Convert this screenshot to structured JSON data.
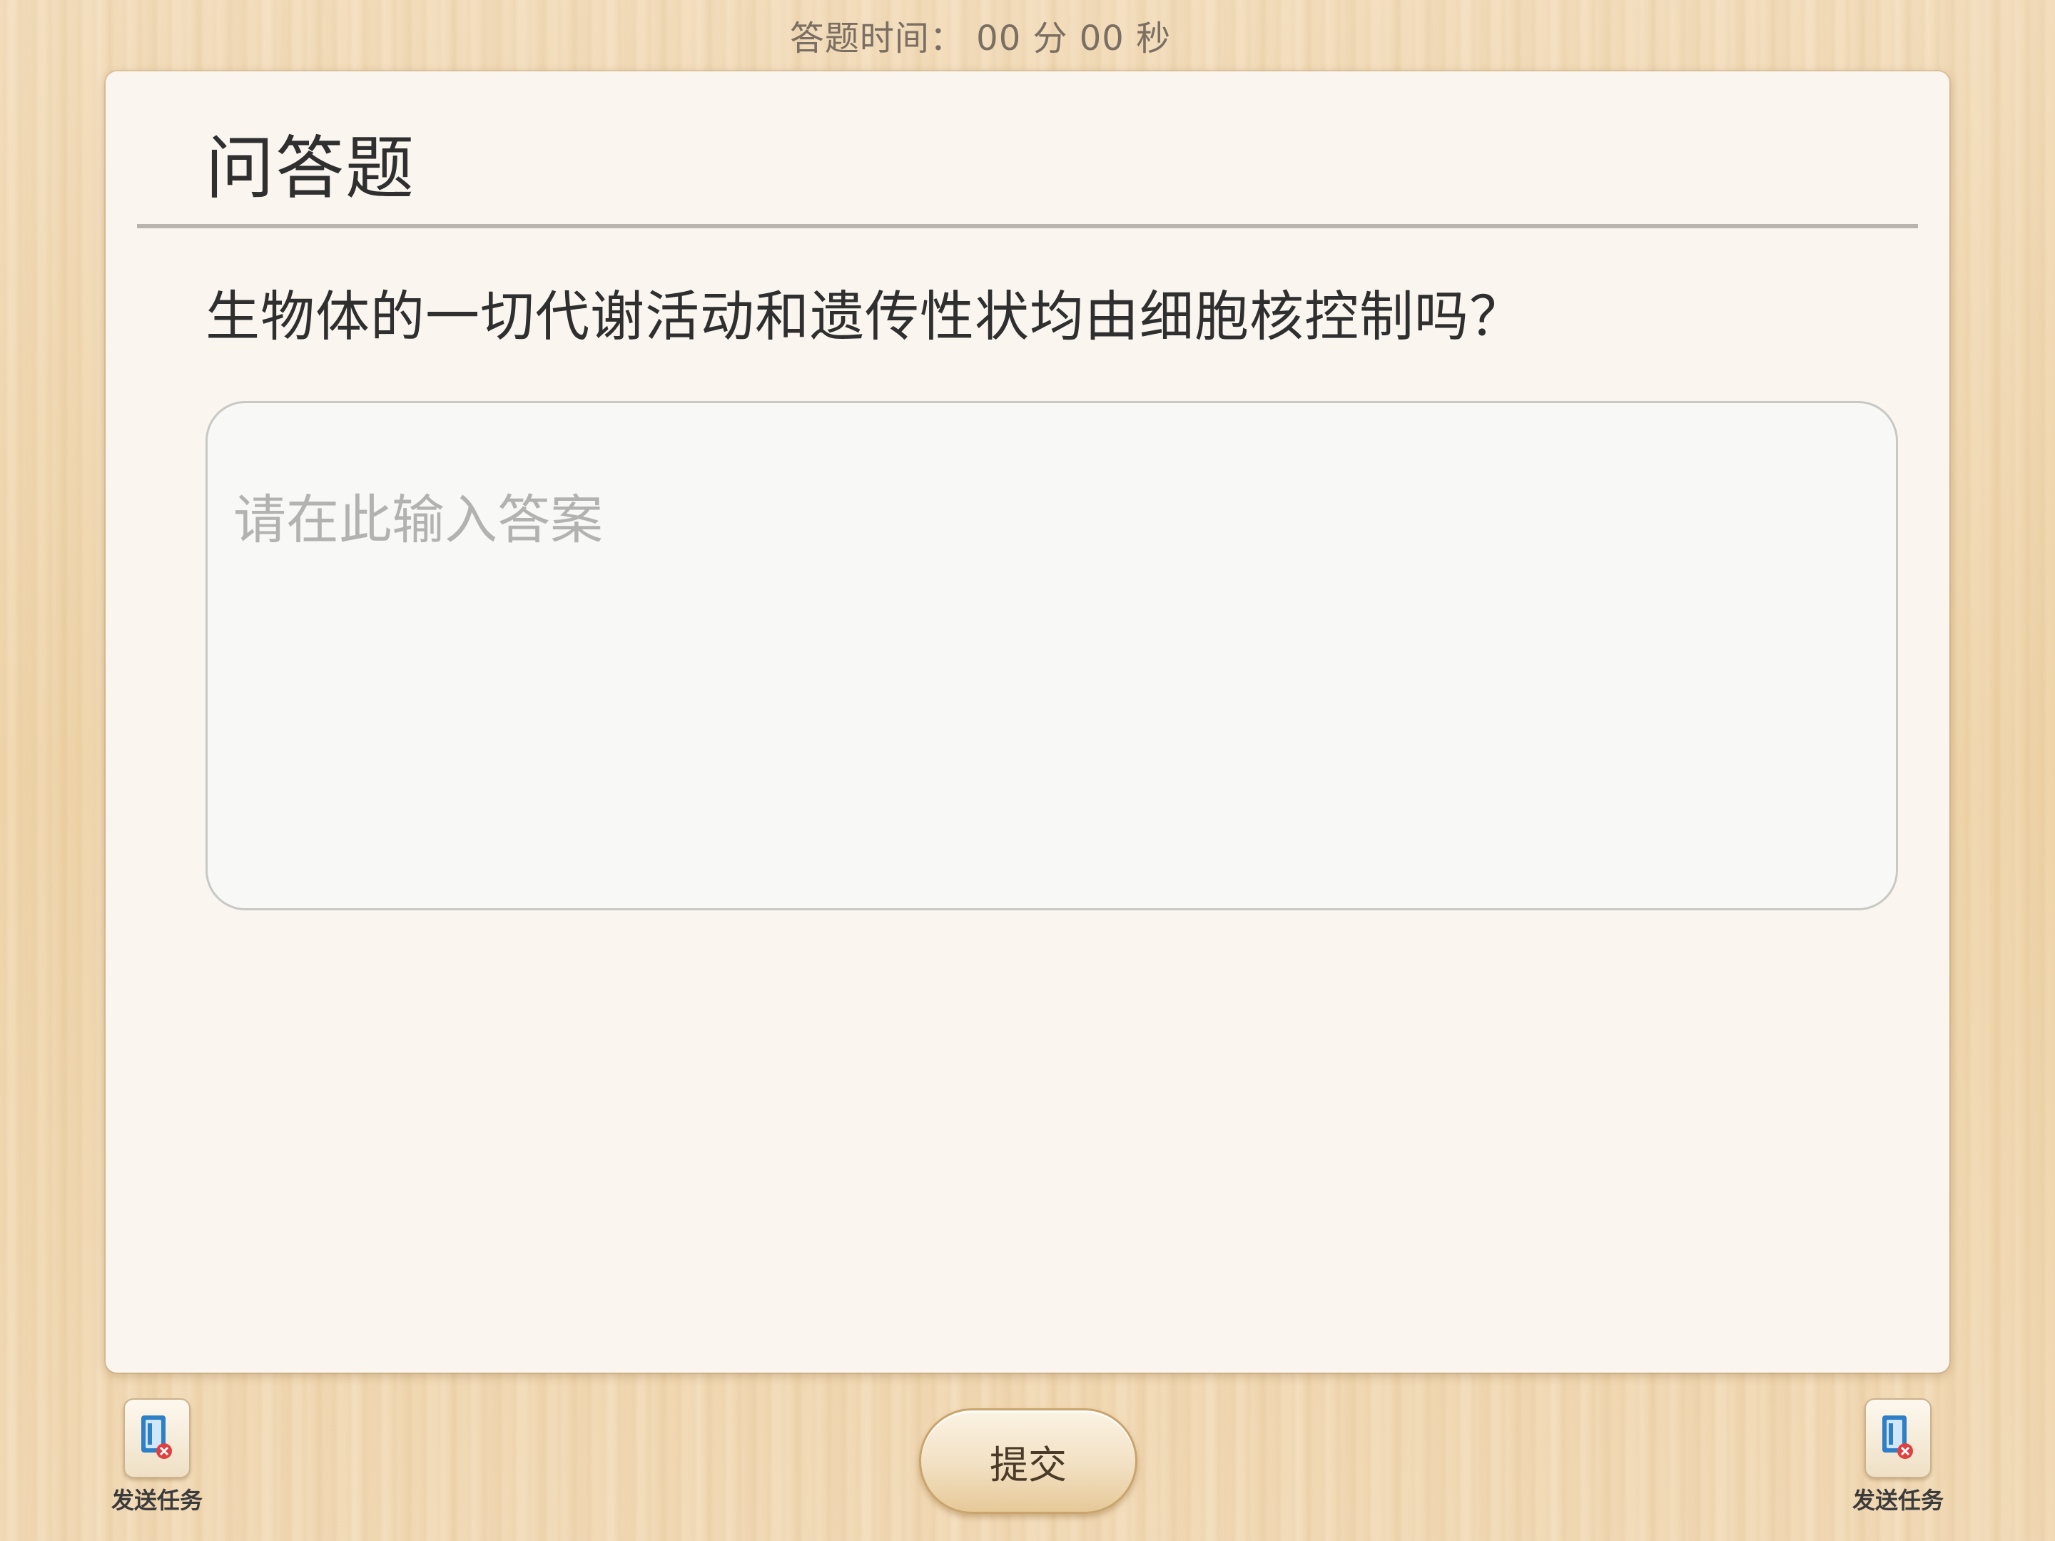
{
  "timer": {
    "text": "答题时间： 00 分 00 秒"
  },
  "card": {
    "title": "问答题",
    "question": "生物体的一切代谢活动和遗传性状均由细胞核控制吗？",
    "answer": {
      "value": "",
      "placeholder": "请在此输入答案"
    }
  },
  "footer": {
    "submit_label": "提交",
    "left_task": {
      "label": "发送任务",
      "icon": "send-task-icon"
    },
    "right_task": {
      "label": "发送任务",
      "icon": "send-task-icon"
    }
  },
  "colors": {
    "background": "#f1d9b3",
    "card": "#faf6ef",
    "text": "#2f2f2f",
    "placeholder": "#b2b2b0",
    "icon_blue": "#2f7fc6",
    "icon_red": "#e04040"
  }
}
